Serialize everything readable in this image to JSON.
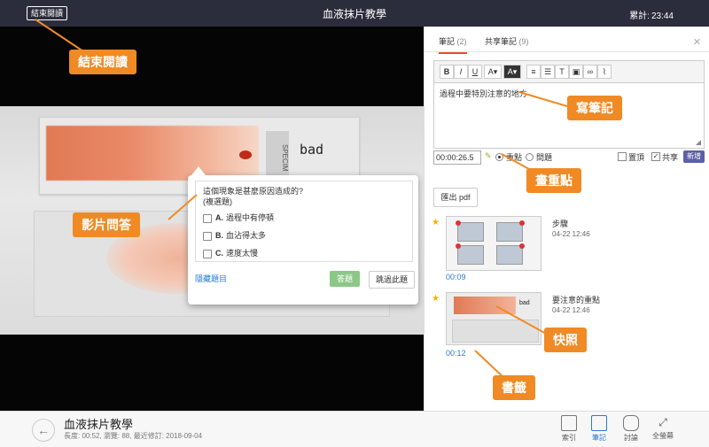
{
  "topbar": {
    "exit_label": "結束閱讀",
    "title": "血液抹片教學",
    "timer_label": "累計:",
    "timer_value": "23:44"
  },
  "video": {
    "slide_label": "bad",
    "specimen_text": "SPECIM"
  },
  "quiz": {
    "question": "這個現象是甚麼原因造成的?",
    "type": "(複選題)",
    "options": [
      {
        "key": "A.",
        "text": "過程中有停頓"
      },
      {
        "key": "B.",
        "text": "血沾得太多"
      },
      {
        "key": "C.",
        "text": "速度太慢"
      }
    ],
    "hide_label": "隱藏題目",
    "answer_label": "答題",
    "skip_label": "跳過此題"
  },
  "sidebar": {
    "tabs": [
      {
        "label": "筆記",
        "count": "(2)"
      },
      {
        "label": "共享筆記",
        "count": "(9)"
      }
    ],
    "note_text": "過程中要特別注意的地方",
    "time_value": "00:00:26.5",
    "radio_labels": [
      "重點",
      "問題"
    ],
    "check_labels": [
      "置頂",
      "共享"
    ],
    "new_label": "新增",
    "export_label": "匯出 pdf",
    "bookmarks": [
      {
        "title": "步驟",
        "date": "04-22 12:46",
        "time": "00:09"
      },
      {
        "title": "要注意的重點",
        "date": "04-22 12:46",
        "time": "00:12"
      }
    ]
  },
  "bottom": {
    "title": "血液抹片教學",
    "meta": "長度: 00:52, 瀏覽: 88, 最近修訂: 2018-09-04",
    "nav": [
      "索引",
      "筆記",
      "討論",
      "全螢幕"
    ]
  },
  "callouts": [
    "結束閱讀",
    "寫筆記",
    "畫重點",
    "影片問答",
    "快照",
    "書籤"
  ],
  "colors": {
    "accent": "#f08a24",
    "topbar": "#2b2d3c",
    "link": "#2a7bd4",
    "new_button": "#5d5fa6"
  }
}
